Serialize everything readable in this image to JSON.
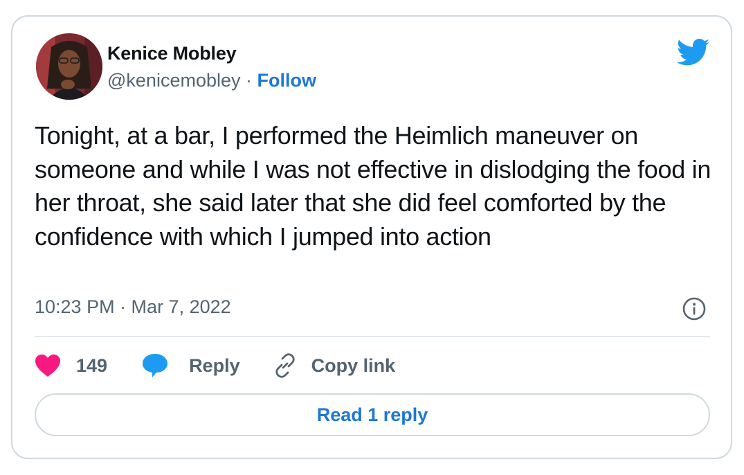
{
  "author": {
    "name": "Kenice Mobley",
    "handle": "@kenicemobley",
    "separator": " · ",
    "follow_label": "Follow",
    "avatar_icon": "avatar-photo"
  },
  "brand": {
    "icon": "twitter-bird-icon",
    "color": "#1d9bf0"
  },
  "tweet": {
    "text": "Tonight, at a bar, I performed the Heimlich maneuver on someone and while I was not effective in dislodging the food in her throat, she said later that she did feel comforted by the confidence with which I jumped into action",
    "timestamp": "10:23 PM · Mar 7, 2022"
  },
  "actions": {
    "like_count": "149",
    "like_color": "#f91880",
    "reply_label": "Reply",
    "reply_icon_color": "#1d9bf0",
    "copy_link_label": "Copy link"
  },
  "read_replies_label": "Read 1 reply",
  "colors": {
    "link": "#1d77d6",
    "secondary_text": "#536471",
    "border": "#cfd9de"
  }
}
